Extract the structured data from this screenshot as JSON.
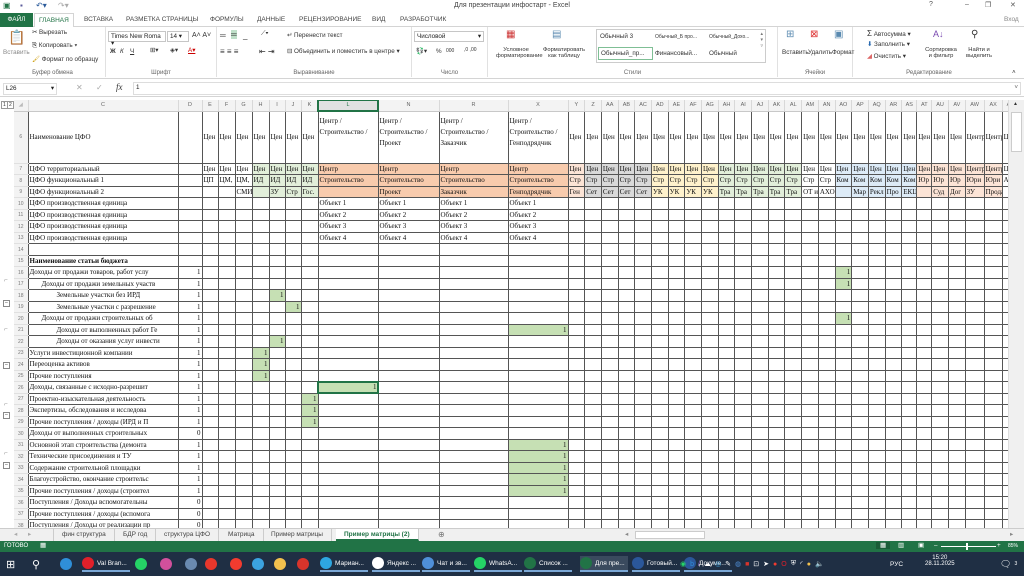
{
  "window": {
    "title": "Для презентации инфостарт - Excel",
    "help": "?",
    "signin": "Вход"
  },
  "ribbon_tabs": [
    "ФАЙЛ",
    "ГЛАВНАЯ",
    "ВСТАВКА",
    "РАЗМЕТКА СТРАНИЦЫ",
    "ФОРМУЛЫ",
    "ДАННЫЕ",
    "РЕЦЕНЗИРОВАНИЕ",
    "ВИД",
    "РАЗРАБОТЧИК"
  ],
  "ribbon": {
    "clipboard": {
      "paste": "Вставить",
      "cut": "Вырезать",
      "copy": "Копировать",
      "format_painter": "Формат по образцу",
      "label": "Буфер обмена"
    },
    "font": {
      "name": "Times New Roma",
      "size": "14",
      "bold": "Ж",
      "italic": "К",
      "underline": "Ч",
      "label": "Шрифт"
    },
    "alignment": {
      "wrap": "Перенести текст",
      "merge": "Объединить и поместить в центре",
      "label": "Выравнивание"
    },
    "number": {
      "format": "Числовой",
      "percent": "%",
      "thousands": "000",
      "label": "Число"
    },
    "styles": {
      "conditional": "Условное форматирование",
      "as_table": "Форматировать как таблицу",
      "items": [
        "Обычный 3",
        "Обычный_Б про...",
        "Обычный_Дохо...",
        "Обычный_пр...",
        "Финансовый...",
        "Обычный"
      ],
      "label": "Стили"
    },
    "cells": {
      "insert": "Вставить",
      "delete": "Удалить",
      "format": "Формат",
      "label": "Ячейки"
    },
    "editing": {
      "autosum": "Автосумма",
      "fill": "Заполнить",
      "clear": "Очистить",
      "sort": "Сортировка и фильтр",
      "find": "Найти и выделить",
      "label": "Редактирование"
    }
  },
  "formula_bar": {
    "name_box": "L26",
    "fx": "fx",
    "value": "1"
  },
  "outline_levels": [
    "1",
    "2"
  ],
  "columns": [
    "C",
    "D",
    "E",
    "F",
    "G",
    "H",
    "I",
    "J",
    "K",
    "L",
    "N",
    "R",
    "X",
    "Y",
    "Z",
    "AA",
    "AB",
    "AC",
    "AD",
    "AE",
    "AF",
    "AG",
    "AH",
    "AI",
    "AJ",
    "AK",
    "AL",
    "AM",
    "AN",
    "AO",
    "AP",
    "AQ",
    "AR",
    "AS",
    "AT",
    "AU",
    "AV",
    "AW",
    "AX",
    "AY"
  ],
  "selected_column": "L",
  "selected_cell": {
    "row": "26",
    "col": "L"
  },
  "header_fills": {
    "H": "#e2efda",
    "I": "#e2efda",
    "J": "#e2efda",
    "K": "#e2efda",
    "L": "#f8cbad",
    "N": "#f8cbad",
    "R": "#f8cbad",
    "X": "#f8cbad",
    "Y": "#fce4d6",
    "Z": "#d9d9d9",
    "AA": "#d9d9d9",
    "AB": "#d9d9d9",
    "AC": "#d9d9d9",
    "AD": "#fff2cc",
    "AE": "#fff2cc",
    "AF": "#fff2cc",
    "AG": "#fff2cc",
    "AH": "#e2efda",
    "AI": "#e2efda",
    "AJ": "#e2efda",
    "AK": "#e2efda",
    "AL": "#e2efda",
    "AO": "#ddebf7",
    "AP": "#ddebf7",
    "AQ": "#ddebf7",
    "AR": "#ddebf7",
    "AS": "#ddebf7",
    "AT": "#fce4d6",
    "AU": "#fce4d6",
    "AV": "#fce4d6",
    "AW": "#fce4d6",
    "AX": "#fce4d6"
  },
  "mark_fill": "#c6e0b4",
  "rows": [
    {
      "n": "6",
      "cells": {
        "C": "Наименование ЦФО",
        "E": "Цен",
        "F": "Цен",
        "G": "Цен",
        "H": "Цен",
        "I": "Цен",
        "J": "Цен",
        "K": "Цен",
        "L": "Центр /Строительство /",
        "N": "Центр /Строительство /Проект",
        "R": "Центр /Строительство /Заказчик",
        "X": "Центр /Строительство /Генподрядчик",
        "Y": "Цен",
        "Z": "Цен",
        "AA": "Цен",
        "AB": "Цен",
        "AC": "Цен",
        "AD": "Цен",
        "AE": "Цен",
        "AF": "Цен",
        "AG": "Цен",
        "AH": "Цен",
        "AI": "Цен",
        "AJ": "Цен",
        "AK": "Цен",
        "AL": "Цен",
        "AM": "Цен",
        "AN": "Цен",
        "AO": "Цен",
        "AP": "Цен",
        "AQ": "Цен",
        "AR": "Цен",
        "AS": "Цен",
        "AT": "Цен",
        "AU": "Цен",
        "AV": "Цен",
        "AW": "Центр",
        "AX": "Центр",
        "AY": "Ц"
      }
    },
    {
      "n": "7",
      "cells": {
        "C": "ЦФО территориальный",
        "E": "Цен",
        "F": "Цен",
        "G": "Цен",
        "H": "Цен",
        "I": "Цен",
        "J": "Цен",
        "K": "Цен",
        "L": "Центр",
        "N": "Центр",
        "R": "Центр",
        "X": "Центр",
        "Y": "Цен",
        "Z": "Цен",
        "AA": "Цен",
        "AB": "Цен",
        "AC": "Цен",
        "AD": "Цен",
        "AE": "Цен",
        "AF": "Цен",
        "AG": "Цен",
        "AH": "Цен",
        "AI": "Цен",
        "AJ": "Цен",
        "AK": "Цен",
        "AL": "Цен",
        "AM": "Цен",
        "AN": "Цен",
        "AO": "Цен",
        "AP": "Цен",
        "AQ": "Цен",
        "AR": "Цен",
        "AS": "Цен",
        "AT": "Цен",
        "AU": "Цен",
        "AV": "Цен",
        "AW": "Центр",
        "AX": "Центр",
        "AY": "Ц"
      }
    },
    {
      "n": "8",
      "cells": {
        "C": "ЦФО функциональный 1",
        "E": "ЦП",
        "F": "ЦМ,",
        "G": "ЦМ,",
        "H": "ИД",
        "I": "ИД",
        "J": "ИД",
        "K": "ИД",
        "L": "Строительство",
        "N": "Строительство",
        "R": "Строительство",
        "X": "Строительство",
        "Y": "Стр",
        "Z": "Стр",
        "AA": "Стр",
        "AB": "Стр",
        "AC": "Стр",
        "AD": "Стр",
        "AE": "Стр",
        "AF": "Стр",
        "AG": "Стр",
        "AH": "Стр",
        "AI": "Стр",
        "AJ": "Стр",
        "AK": "Стр",
        "AL": "Стр",
        "AM": "Стр",
        "AN": "Стр",
        "AO": "Ком",
        "AP": "Ком",
        "AQ": "Ком",
        "AR": "Ком",
        "AS": "Ком",
        "AT": "Юр",
        "AU": "Юр",
        "AV": "Юр",
        "AW": "Юри",
        "AX": "Юри",
        "AY": "А"
      }
    },
    {
      "n": "9",
      "cells": {
        "C": "ЦФО функциональный 2",
        "G": "СМИ",
        "I": "ЗУ",
        "J": "Стр",
        "K": "Гос.",
        "N": "Проект",
        "R": "Заказчик",
        "X": "Генподрядчик",
        "Y": "Ген",
        "Z": "Сет",
        "AA": "Сет",
        "AB": "Сет",
        "AC": "Сет",
        "AD": "УК",
        "AE": "УК",
        "AF": "УК",
        "AG": "УК",
        "AH": "Тра",
        "AI": "Тра",
        "AJ": "Тра",
        "AK": "Тра",
        "AL": "Тра",
        "AM": "ОТ и",
        "AN": "АХО",
        "AP": "Мар",
        "AQ": "Рекл",
        "AR": "Про",
        "AS": "ЕКЦ",
        "AU": "Суд",
        "AV": "Дог",
        "AW": "ЗУ",
        "AX": "Продаж"
      }
    },
    {
      "n": "10",
      "cells": {
        "C": "ЦФО производственная единица",
        "L": "Объект 1",
        "N": "Объект 1",
        "R": "Объект 1",
        "X": "Объект 1"
      }
    },
    {
      "n": "11",
      "cells": {
        "C": "ЦФО производственная единица",
        "L": "Объект 2",
        "N": "Объект 2",
        "R": "Объект 2",
        "X": "Объект 2"
      }
    },
    {
      "n": "12",
      "cells": {
        "C": "ЦФО производственная единица",
        "L": "Объект 3",
        "N": "Объект 3",
        "R": "Объект 3",
        "X": "Объект 3"
      }
    },
    {
      "n": "13",
      "cells": {
        "C": "ЦФО производственная единица",
        "L": "Объект 4",
        "N": "Объект 4",
        "R": "Объект 4",
        "X": "Объект 4"
      }
    },
    {
      "n": "14",
      "cells": {}
    },
    {
      "n": "15",
      "bold": true,
      "cells": {
        "C": "Наименование статьи бюджета"
      }
    },
    {
      "n": "16",
      "indent": 0,
      "cells": {
        "C": "Доходы от продажи товаров, работ услу",
        "D": "1",
        "AO": "1"
      }
    },
    {
      "n": "17",
      "indent": 1,
      "cells": {
        "C": "Доходы от продажи земельных участв",
        "D": "1",
        "AO": "1"
      }
    },
    {
      "n": "18",
      "indent": 2,
      "cells": {
        "C": "Земельные участки без ИРД",
        "D": "1",
        "I": "1"
      }
    },
    {
      "n": "19",
      "indent": 2,
      "cells": {
        "C": "Земельные участки с разрешение",
        "D": "1",
        "J": "1"
      }
    },
    {
      "n": "20",
      "indent": 1,
      "cells": {
        "C": "Доходы от продажи строительных об",
        "D": "1",
        "AO": "1"
      }
    },
    {
      "n": "21",
      "indent": 2,
      "cells": {
        "C": "Доходы от выполненных работ Ге",
        "D": "1",
        "X": "1"
      }
    },
    {
      "n": "22",
      "indent": 2,
      "cells": {
        "C": "Доходы от оказания услуг инвести",
        "D": "1",
        "I": "1"
      }
    },
    {
      "n": "23",
      "cells": {
        "C": "Услуги инвестиционной компании",
        "D": "1",
        "H": "1"
      }
    },
    {
      "n": "24",
      "cells": {
        "C": "Переоценка активов",
        "D": "1",
        "H": "1"
      }
    },
    {
      "n": "25",
      "cells": {
        "C": "Прочие поступления",
        "D": "1",
        "H": "1"
      }
    },
    {
      "n": "26",
      "cells": {
        "C": "Доходы, связанные с исходно-разрешит",
        "D": "1",
        "L": "1"
      }
    },
    {
      "n": "27",
      "cells": {
        "C": "Проектно-изыскательная деятельность",
        "D": "1",
        "K": "1"
      }
    },
    {
      "n": "28",
      "cells": {
        "C": "Экспертизы, обследования и исследова",
        "D": "1",
        "K": "1"
      }
    },
    {
      "n": "29",
      "cells": {
        "C": "Прочие поступления / доходы (ИРД и П",
        "D": "1",
        "K": "1"
      }
    },
    {
      "n": "30",
      "cells": {
        "C": "Доходы от выполненных строительных",
        "D": "0"
      }
    },
    {
      "n": "31",
      "cells": {
        "C": "Основной этап строительства (демонта",
        "D": "1",
        "X": "1"
      }
    },
    {
      "n": "32",
      "cells": {
        "C": "Технические присоединения и ТУ",
        "D": "1",
        "X": "1"
      }
    },
    {
      "n": "33",
      "cells": {
        "C": "Содержание строительной площадки",
        "D": "1",
        "X": "1"
      }
    },
    {
      "n": "34",
      "cells": {
        "C": "Благоустройство, окончание строительс",
        "D": "1",
        "X": "1"
      }
    },
    {
      "n": "35",
      "cells": {
        "C": "Прочие поступления / доходы (строител",
        "D": "1",
        "X": "1"
      }
    },
    {
      "n": "36",
      "cells": {
        "C": "Поступления / Доходы вспомогательны",
        "D": "0"
      }
    },
    {
      "n": "37",
      "cells": {
        "C": "Прочие поступления / доходы (вспомога",
        "D": "0"
      }
    },
    {
      "n": "38",
      "cells": {
        "C": "Поступления / Доходы от реализации пр",
        "D": "0"
      }
    }
  ],
  "sheet_tabs": [
    "фин структура",
    "БДР год",
    "структура ЦФО",
    "Матрица",
    "Пример матрицы",
    "Пример матрицы (2)"
  ],
  "active_sheet": "Пример матрицы (2)",
  "status": {
    "ready": "ГОТОВО",
    "zoom": "85%"
  },
  "taskbar": {
    "apps": [
      {
        "label": "",
        "icon": "edge-icon",
        "color": "#2f8fd8"
      },
      {
        "label": "Val Bran...",
        "icon": "opera-icon",
        "color": "#e0202a"
      },
      {
        "label": "",
        "icon": "whatsapp-icon",
        "color": "#25d366"
      },
      {
        "label": "",
        "icon": "colorful-app-icon",
        "color": "#d2509c"
      },
      {
        "label": "",
        "icon": "remote-desktop-icon",
        "color": "#6a8ab0"
      },
      {
        "label": "",
        "icon": "red-app-icon",
        "color": "#e8372c"
      },
      {
        "label": "",
        "icon": "yandex-icon",
        "color": "#f23b2f"
      },
      {
        "label": "",
        "icon": "cloud-24-icon",
        "color": "#3ba3e0"
      },
      {
        "label": "",
        "icon": "folder-icon",
        "color": "#f2c14e"
      },
      {
        "label": "",
        "icon": "snip-icon",
        "color": "#d9342b"
      },
      {
        "label": "Мариан...",
        "icon": "telegram-icon",
        "color": "#2ea6e0"
      },
      {
        "label": "Яндекс ...",
        "icon": "yandex-browser-icon",
        "color": "#ffffff"
      },
      {
        "label": "Чат и зв...",
        "icon": "chat-icon",
        "color": "#4f8fd8"
      },
      {
        "label": "WhatsA...",
        "icon": "whatsapp-icon",
        "color": "#25d366"
      },
      {
        "label": "Список ...",
        "icon": "excel-icon",
        "color": "#217346"
      },
      {
        "label": "Для пре...",
        "icon": "excel-icon",
        "color": "#217346",
        "active": true
      },
      {
        "label": "Готовый...",
        "icon": "word-icon",
        "color": "#2b579a"
      },
      {
        "label": "Докуме...",
        "icon": "word-icon",
        "color": "#2b579a"
      }
    ],
    "lang": "РУС",
    "time": "15:20",
    "date": "28.11.2025",
    "notifications": "3"
  }
}
